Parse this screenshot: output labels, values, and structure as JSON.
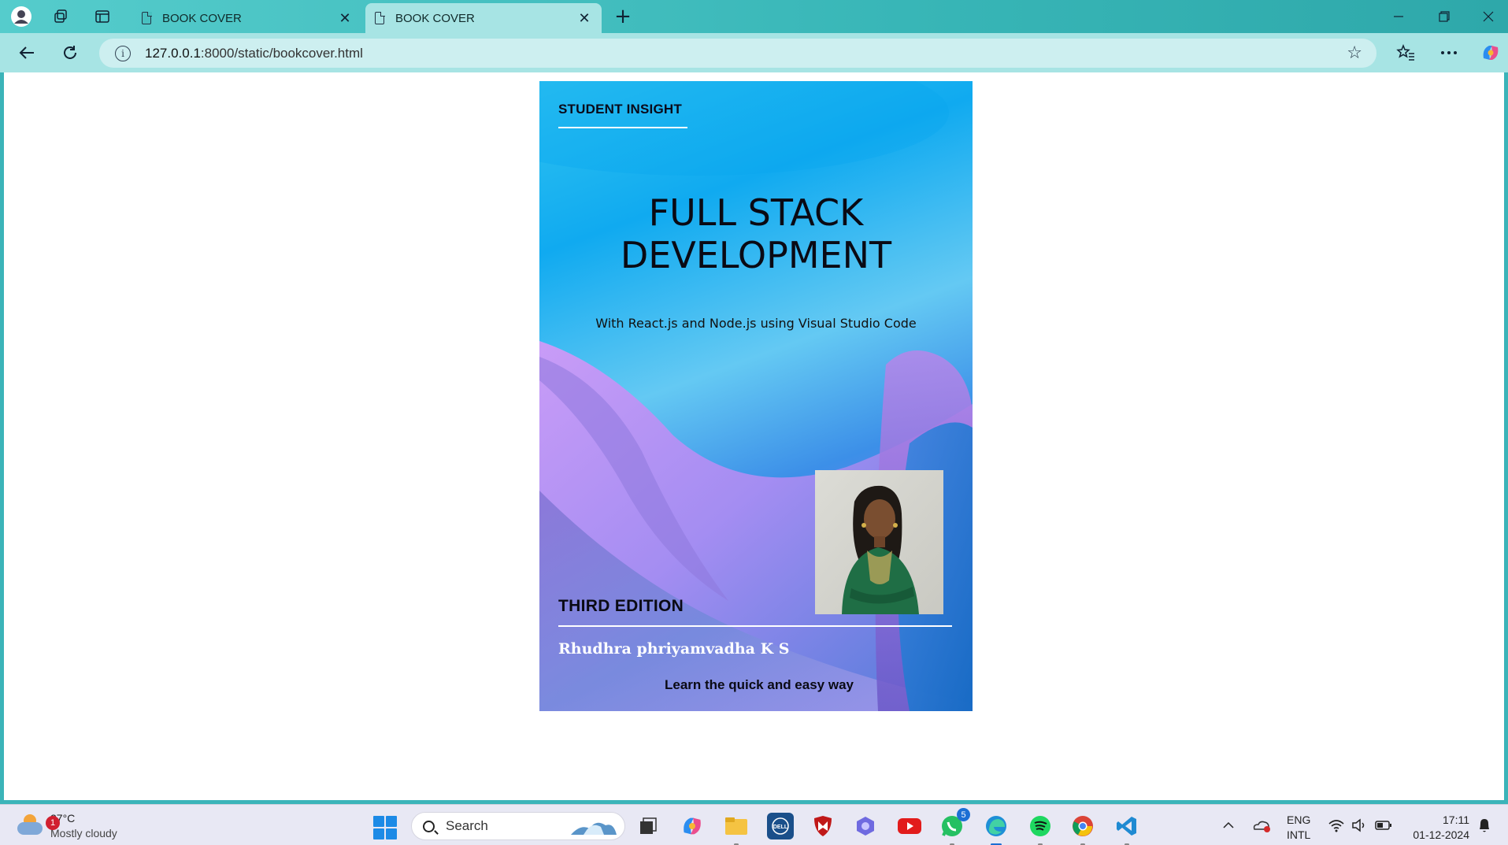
{
  "browser": {
    "tabs": [
      {
        "label": "BOOK COVER",
        "active": false
      },
      {
        "label": "BOOK COVER",
        "active": true
      }
    ],
    "url_host": "127.0.0.1",
    "url_rest": ":8000/static/bookcover.html"
  },
  "cover": {
    "kicker": "STUDENT INSIGHT",
    "title_line1": "FULL STACK",
    "title_line2": "DEVELOPMENT",
    "subtitle": "With React.js and Node.js using Visual Studio Code",
    "edition": "THIRD EDITION",
    "author": "Rhudhra phriyamvadha K S",
    "tagline": "Learn the quick and easy way"
  },
  "taskbar": {
    "weather_temp": "27°C",
    "weather_condition": "Mostly cloudy",
    "weather_badge": "1",
    "search_label": "Search",
    "whatsapp_badge": "5",
    "lang_line1": "ENG",
    "lang_line2": "INTL",
    "time": "17:11",
    "date": "01-12-2024"
  },
  "colors": {
    "tabbar": "#38b6b7",
    "toolbar": "#a7e4e4",
    "cover_top": "#10aaf0",
    "cover_bottom": "#1671c6"
  }
}
